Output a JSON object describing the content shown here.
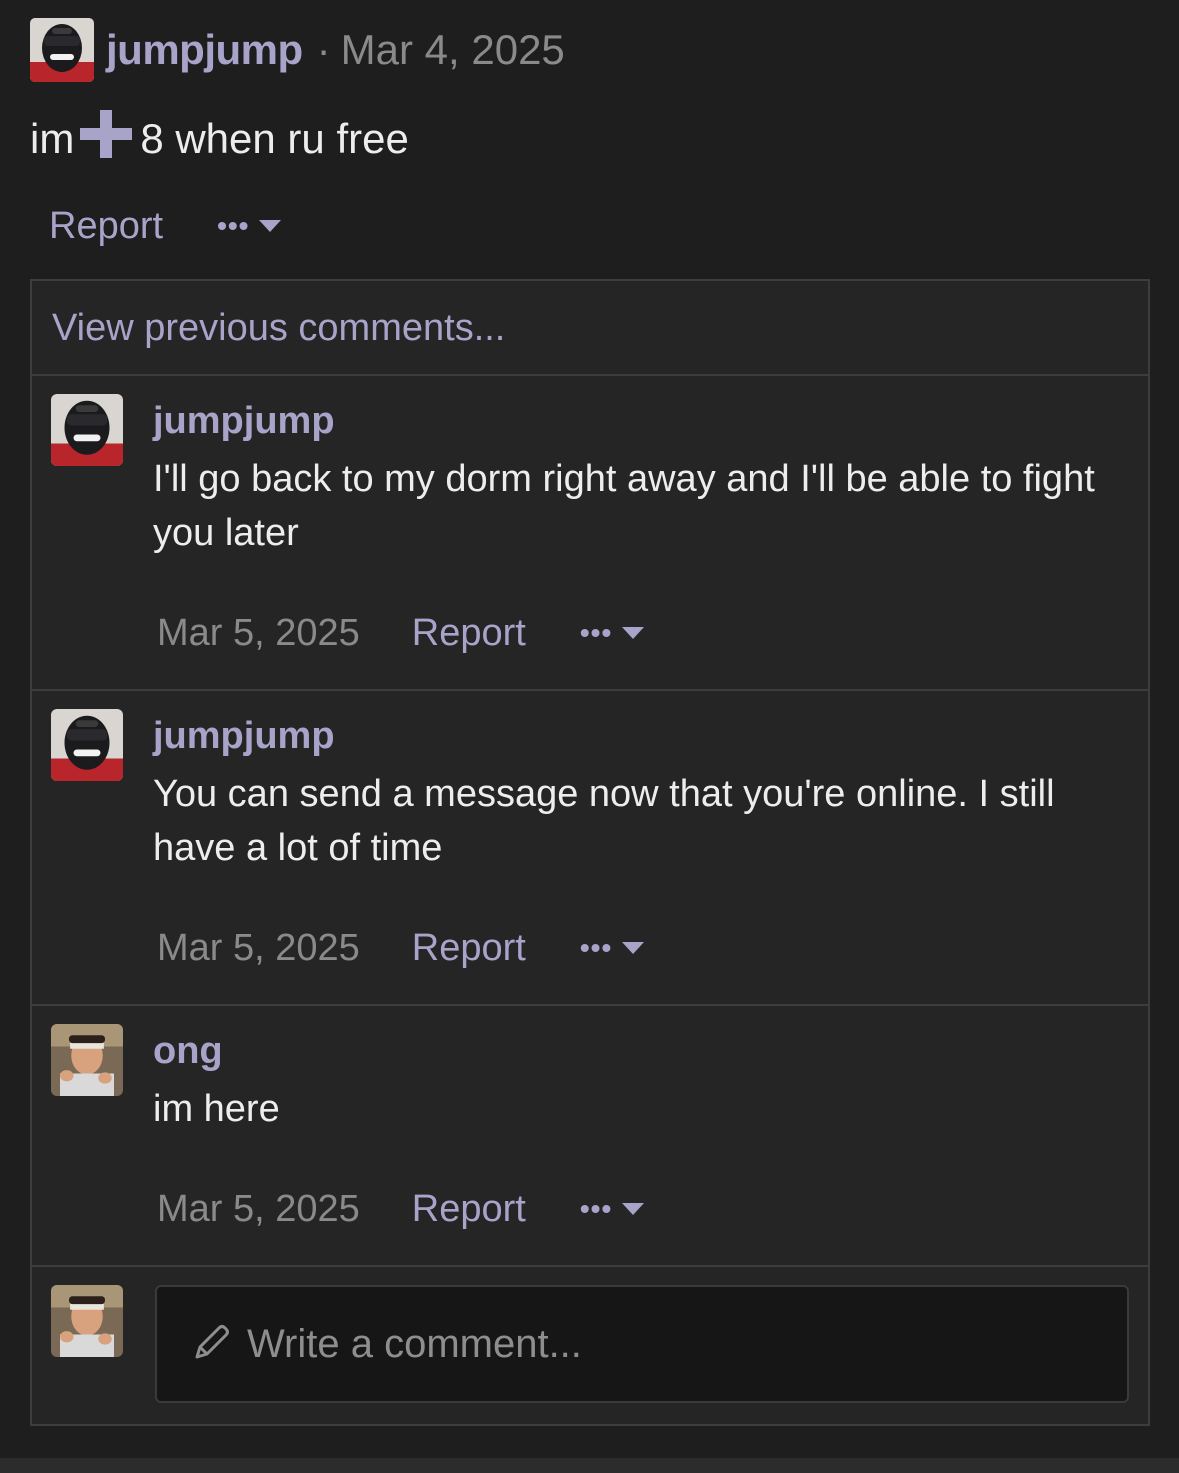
{
  "post": {
    "username": "jumpjump",
    "separator": "·",
    "date": "Mar 4, 2025",
    "text_before": "im",
    "emoji_icon": "plus-icon",
    "text_after": "8 when ru free",
    "report_label": "Report",
    "more_label": "•••"
  },
  "thread": {
    "view_previous": "View previous comments...",
    "comments": [
      {
        "username": "jumpjump",
        "avatar": "masked-person-avatar",
        "text": "I'll go back to my dorm right away and I'll be able to fight you later",
        "date": "Mar 5, 2025",
        "report_label": "Report",
        "more_label": "•••"
      },
      {
        "username": "jumpjump",
        "avatar": "masked-person-avatar",
        "text": "You can send a message now that you're online. I still have a lot of time",
        "date": "Mar 5, 2025",
        "report_label": "Report",
        "more_label": "•••"
      },
      {
        "username": "ong",
        "avatar": "headband-person-avatar",
        "text": "im here",
        "date": "Mar 5, 2025",
        "report_label": "Report",
        "more_label": "•••"
      }
    ],
    "compose_placeholder": "Write a comment..."
  },
  "colors": {
    "background": "#1e1e1e",
    "panel": "#252525",
    "accent": "#a8a3c9",
    "muted": "#8a8a8a",
    "text": "#ededed",
    "border": "#3d3d3d"
  }
}
